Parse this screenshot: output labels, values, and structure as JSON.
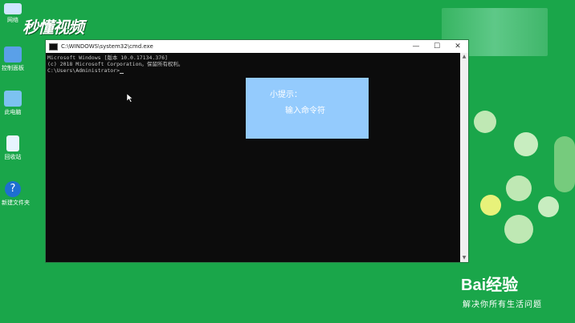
{
  "desktop": {
    "icons": [
      {
        "label": "网络",
        "icon": "network-icon",
        "color": "#cfe6ff"
      },
      {
        "label": "控制面板",
        "icon": "control-panel-icon",
        "color": "#5aa0e8"
      },
      {
        "label": "此电脑",
        "icon": "computer-icon",
        "color": "#7cc2f0"
      },
      {
        "label": "回收站",
        "icon": "recycle-bin-icon",
        "color": "#e8f4ff"
      },
      {
        "label": "新建文件夹",
        "icon": "help-icon",
        "color": "#1e6fd0"
      }
    ]
  },
  "watermark": {
    "logo_text": "秒懂视频",
    "baidu_text": "Bai经验",
    "baidu_sub": "解决你所有生活问题"
  },
  "cmd": {
    "title": "C:\\WINDOWS\\system32\\cmd.exe",
    "lines": [
      "Microsoft Windows [版本 10.0.17134.376]",
      "(c) 2018 Microsoft Corporation。保留所有权利。",
      "",
      "C:\\Users\\Administrator>"
    ],
    "controls": {
      "minimize": "—",
      "maximize": "☐",
      "close": "✕"
    }
  },
  "tip": {
    "title": "小提示：",
    "text": "输入命令符"
  },
  "colors": {
    "desktop_bg": "#1aa64a",
    "tip_bg": "#94cbfd",
    "console_bg": "#0c0c0c"
  }
}
